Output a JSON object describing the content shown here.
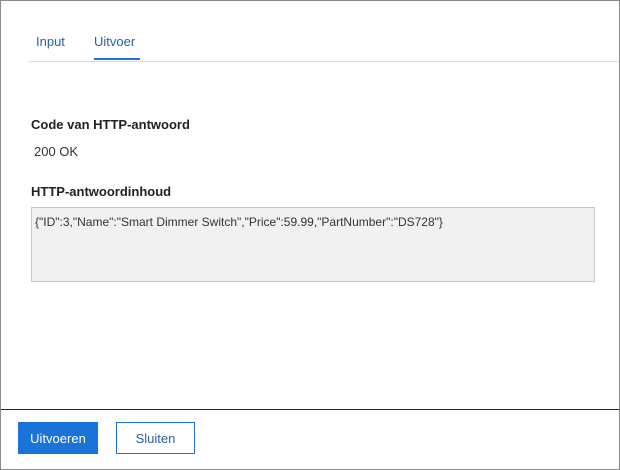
{
  "tabs": [
    {
      "label": "Input",
      "active": false
    },
    {
      "label": "Uitvoer",
      "active": true
    }
  ],
  "output": {
    "status_label": "Code van HTTP-antwoord",
    "status_value": "200 OK",
    "body_label": "HTTP-antwoordinhoud",
    "body_value": "{\"ID\":3,\"Name\":\"Smart Dimmer Switch\",\"Price\":59.99,\"PartNumber\":\"DS728\"}"
  },
  "footer": {
    "run_label": "Uitvoeren",
    "close_label": "Sluiten"
  },
  "colors": {
    "accent": "#1a73d9",
    "tab_text": "#2a5fa8",
    "body_background": "#f1f1f1"
  }
}
